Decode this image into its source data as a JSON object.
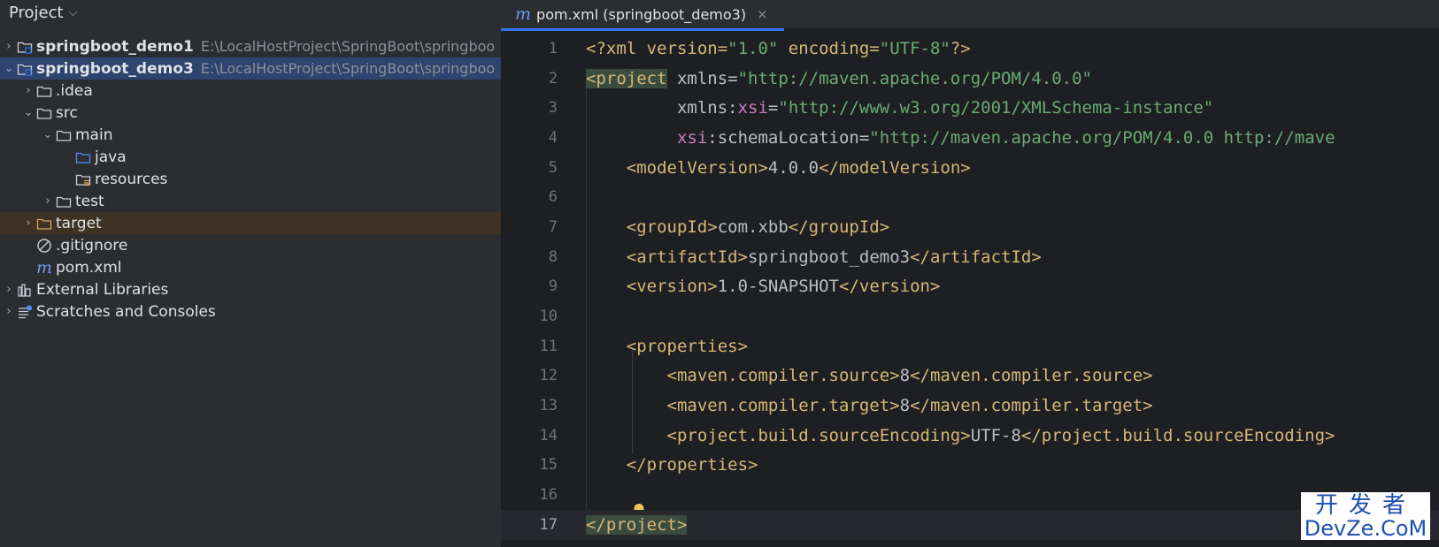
{
  "panel": {
    "title": "Project"
  },
  "tree": [
    {
      "label": "springboot_demo1",
      "path": "E:\\LocalHostProject\\SpringBoot\\springboo",
      "expanded": false
    },
    {
      "label": "springboot_demo3",
      "path": "E:\\LocalHostProject\\SpringBoot\\springboo",
      "expanded": true
    },
    {
      "label": ".idea"
    },
    {
      "label": "src"
    },
    {
      "label": "main"
    },
    {
      "label": "java"
    },
    {
      "label": "resources"
    },
    {
      "label": "test"
    },
    {
      "label": "target"
    },
    {
      "label": ".gitignore"
    },
    {
      "label": "pom.xml"
    },
    {
      "label": "External Libraries"
    },
    {
      "label": "Scratches and Consoles"
    }
  ],
  "editor": {
    "tab_label": "pom.xml (springboot_demo3)",
    "tab_close": "×",
    "current_line": 17
  },
  "code": {
    "l1": {
      "a": "<?xml version=",
      "b": "\"1.0\"",
      "c": " encoding=",
      "d": "\"UTF-8\"",
      "e": "?>"
    },
    "l2": {
      "a": "<project",
      "b": " xmlns=",
      "c": "\"http://maven.apache.org/POM/4.0.0\""
    },
    "l3": {
      "a": "         xmlns:",
      "b": "xsi",
      "c": "=",
      "d": "\"http://www.w3.org/2001/XMLSchema-instance\""
    },
    "l4": {
      "a": "         ",
      "b": "xsi",
      "c": ":schemaLocation=",
      "d": "\"http://maven.apache.org/POM/4.0.0 http://mave"
    },
    "l5": {
      "a": "    ",
      "b": "<modelVersion>",
      "c": "4.0.0",
      "d": "</modelVersion>"
    },
    "l7": {
      "a": "    ",
      "b": "<groupId>",
      "c": "com.xbb",
      "d": "</groupId>"
    },
    "l8": {
      "a": "    ",
      "b": "<artifactId>",
      "c": "springboot_demo3",
      "d": "</artifactId>"
    },
    "l9": {
      "a": "    ",
      "b": "<version>",
      "c": "1.0-SNAPSHOT",
      "d": "</version>"
    },
    "l11": {
      "a": "    ",
      "b": "<properties>"
    },
    "l12": {
      "a": "        ",
      "b": "<maven.compiler.source>",
      "c": "8",
      "d": "</maven.compiler.source>"
    },
    "l13": {
      "a": "        ",
      "b": "<maven.compiler.target>",
      "c": "8",
      "d": "</maven.compiler.target>"
    },
    "l14": {
      "a": "        ",
      "b": "<project.build.sourceEncoding>",
      "c": "UTF-8",
      "d": "</project.build.sourceEncoding>"
    },
    "l15": {
      "a": "    ",
      "b": "</properties>"
    },
    "l17": {
      "a": "</project>"
    }
  },
  "line_numbers": [
    "1",
    "2",
    "3",
    "4",
    "5",
    "6",
    "7",
    "8",
    "9",
    "10",
    "11",
    "12",
    "13",
    "14",
    "15",
    "16",
    "17"
  ],
  "watermark": {
    "line1": "开发者",
    "line2": "DevZe.CoM"
  },
  "colors": {
    "tag": "#d5b778",
    "string": "#6aab73",
    "namespace": "#c77dbb",
    "selection": "#2e436e",
    "accent": "#3574f0"
  },
  "icons": {
    "module": "module-folder-icon",
    "folder": "folder-icon",
    "source_root": "source-folder-icon",
    "resources_root": "resources-folder-icon",
    "excluded": "excluded-folder-icon",
    "ignore": "gitignore-icon",
    "maven": "maven-icon",
    "libraries": "libraries-icon",
    "scratches": "scratches-icon",
    "bulb": "intention-bulb-icon"
  }
}
